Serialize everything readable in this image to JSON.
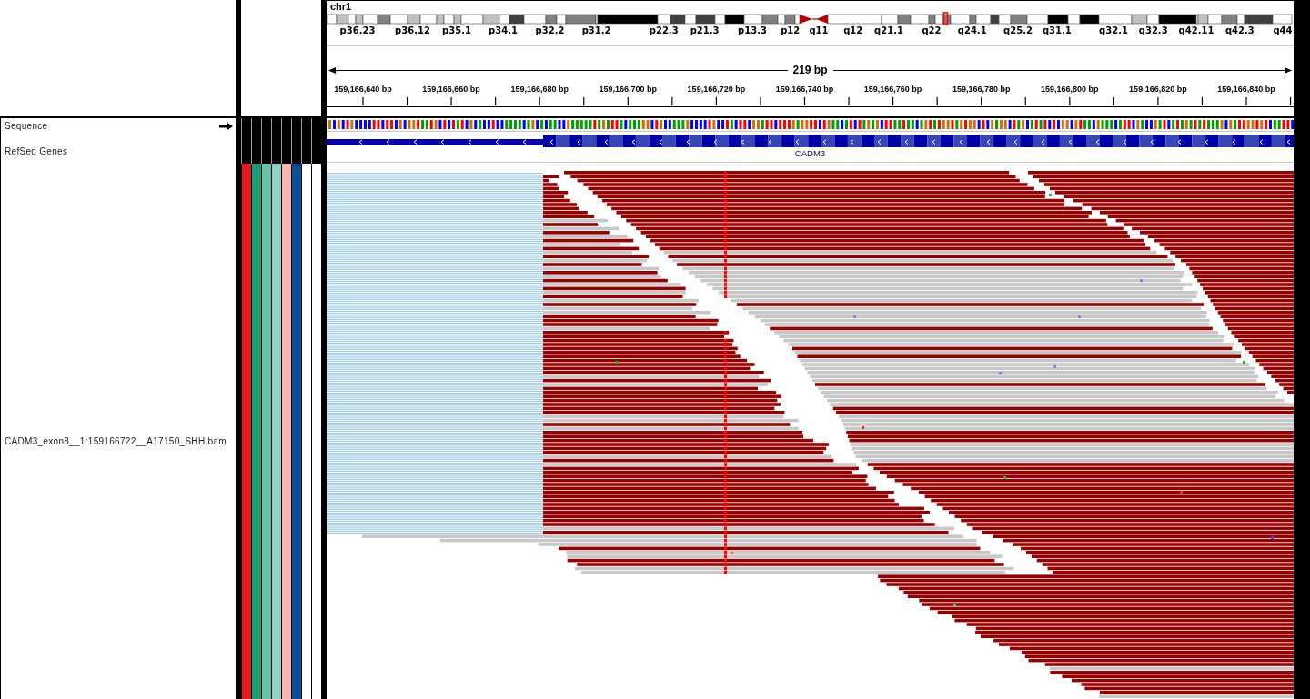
{
  "header": {
    "chromosome": "chr1",
    "band_labels": [
      "p36.23",
      "p36.12",
      "p35.1",
      "p34.1",
      "p32.2",
      "p31.2",
      "p22.3",
      "p21.3",
      "p13.3",
      "p12",
      "q11",
      "q12",
      "q21.1",
      "q22",
      "q24.1",
      "q25.2",
      "q31.1",
      "q32.1",
      "q32.3",
      "q42.11",
      "q42.3",
      "q44"
    ],
    "span": "219 bp",
    "ruler_labels": [
      "159,166,640 bp",
      "159,166,660 bp",
      "159,166,680 bp",
      "159,166,700 bp",
      "159,166,720 bp",
      "159,166,740 bp",
      "159,166,760 bp",
      "159,166,780 bp",
      "159,166,800 bp",
      "159,166,820 bp",
      "159,166,840 bp"
    ]
  },
  "tracks": [
    {
      "kind": "sequence",
      "name": "Sequence",
      "forward_strand": true
    },
    {
      "kind": "gene",
      "name": "RefSeq Genes",
      "forward_strand": false,
      "gene": "CADM3"
    },
    {
      "kind": "alignment",
      "name": "CADM3_exon8__1:159166722__A17150_SHH.bam",
      "attributes": [
        {
          "color": "#e41a1c"
        },
        {
          "color": "#1b9e77"
        },
        {
          "color": "#66c2a5"
        },
        {
          "color": "#8dd3c7"
        },
        {
          "color": "#fbb4ae"
        },
        {
          "color": "#08519c"
        },
        {
          "color": "#ffffff"
        },
        {
          "color": "#ffffff"
        }
      ]
    }
  ]
}
